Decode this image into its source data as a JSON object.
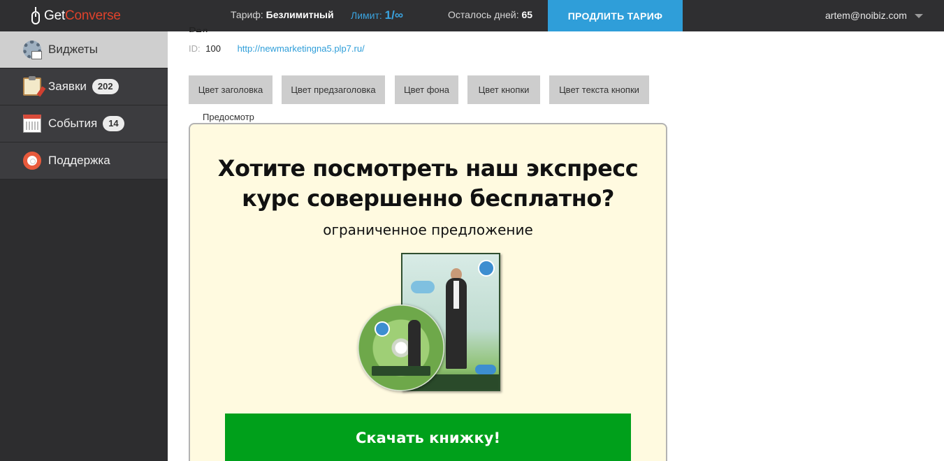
{
  "header": {
    "logo": {
      "part1": "Get",
      "part2": "Converse"
    },
    "plan_label": "Тариф:",
    "plan_value": "Безлимитный",
    "limit_label": "Лимит:",
    "limit_value": "1/∞",
    "days_label": "Осталось дней:",
    "days_value": "65",
    "renew_button": "ПРОДЛИТЬ ТАРИФ",
    "account_email": "artem@noibiz.com",
    "accent_color": "#2f9ed9"
  },
  "sidebar": {
    "items": [
      {
        "label": "Виджеты",
        "icon": "widgets-gear-icon",
        "active": true
      },
      {
        "label": "Заявки",
        "icon": "clipboard-icon",
        "badge": "202"
      },
      {
        "label": "События",
        "icon": "calendar-icon",
        "badge": "14"
      },
      {
        "label": "Поддержка",
        "icon": "lifebuoy-icon"
      }
    ]
  },
  "widget": {
    "title_fragment": "Ред",
    "id_label": "ID:",
    "id_value": "100",
    "url": "http://newmarketingna5.plp7.ru/"
  },
  "color_buttons": [
    "Цвет заголовка",
    "Цвет предзаголовка",
    "Цвет фона",
    "Цвет кнопки",
    "Цвет текста кнопки"
  ],
  "preview": {
    "label": "Предосмотр",
    "headline": "Хотите посмотреть наш экспресс курс совершенно бесплатно?",
    "subheadline": "ограниченное предложение",
    "product_image": "dvd-product-image",
    "button_label": "Скачать книжку!",
    "background_color": "#fffae0",
    "button_color": "#00a01b"
  }
}
